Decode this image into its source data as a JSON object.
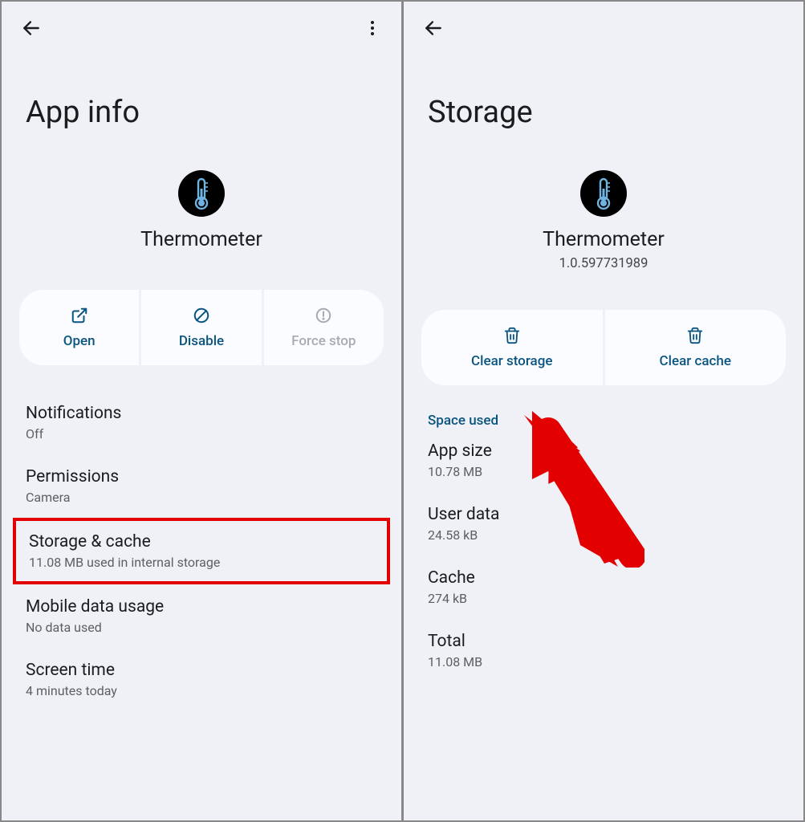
{
  "left": {
    "title": "App info",
    "app_name": "Thermometer",
    "buttons": {
      "open": "Open",
      "disable": "Disable",
      "force_stop": "Force stop"
    },
    "items": [
      {
        "title": "Notifications",
        "sub": "Off"
      },
      {
        "title": "Permissions",
        "sub": "Camera"
      },
      {
        "title": "Storage & cache",
        "sub": "11.08 MB used in internal storage"
      },
      {
        "title": "Mobile data usage",
        "sub": "No data used"
      },
      {
        "title": "Screen time",
        "sub": "4 minutes today"
      }
    ]
  },
  "right": {
    "title": "Storage",
    "app_name": "Thermometer",
    "version": "1.0.597731989",
    "buttons": {
      "clear_storage": "Clear storage",
      "clear_cache": "Clear cache"
    },
    "section_label": "Space used",
    "stats": [
      {
        "label": "App size",
        "value": "10.78 MB"
      },
      {
        "label": "User data",
        "value": "24.58 kB"
      },
      {
        "label": "Cache",
        "value": "274 kB"
      },
      {
        "label": "Total",
        "value": "11.08 MB"
      }
    ]
  }
}
